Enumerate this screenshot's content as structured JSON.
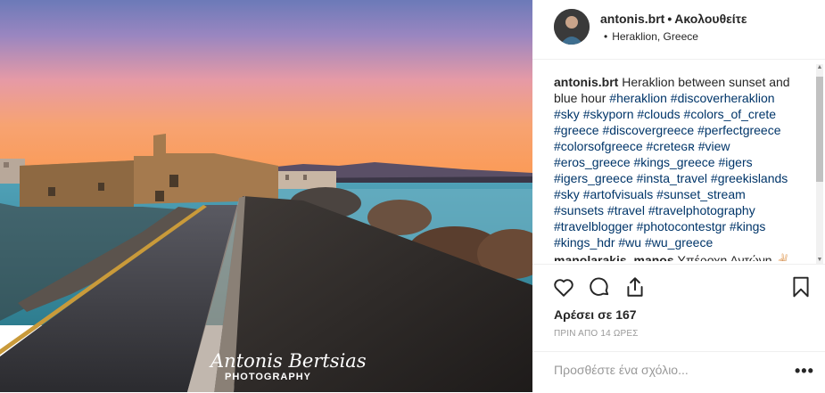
{
  "post": {
    "username": "antonis.brt",
    "separator": "•",
    "follow_label": "Ακολουθείτε",
    "location": "Heraklion, Greece",
    "location_bullet": "•"
  },
  "caption": {
    "username": "antonis.brt",
    "text": "Heraklion between sunset and blue hour",
    "hashtags": [
      "#heraklion",
      "#discoverheraklion",
      "#sky",
      "#skyporn",
      "#clouds",
      "#colors_of_crete",
      "#greece",
      "#discovergreece",
      "#perfectgreece",
      "#colorsofgreece",
      "#creteɢʀ",
      "#view",
      "#eros_greece",
      "#kings_greece",
      "#igers",
      "#igers_greece",
      "#insta_travel",
      "#greekislands",
      "#sky",
      "#artofvisuals",
      "#sunset_stream",
      "#sunsets",
      "#travel",
      "#travelphotography",
      "#travelblogger",
      "#photocontestgr",
      "#kings",
      "#kings_hdr",
      "#wu",
      "#wu_greece"
    ]
  },
  "comment": {
    "username": "manolarakis_manos",
    "text": "Υπέροχη Αντώνη ✌🏻"
  },
  "likes_label": "Αρέσει σε 167",
  "time_label": "ΠΡΙΝ ΑΠΟ 14 ΩΡΕΣ",
  "add_comment_placeholder": "Προσθέστε ένα σχόλιο...",
  "more_label": "•••",
  "watermark": {
    "name": "Antonis Bertsias",
    "sub": "PHOTOGRAPHY"
  },
  "icons": [
    "heart-icon",
    "comment-icon",
    "share-icon",
    "bookmark-icon"
  ],
  "colors": {
    "hashtag": "#003569",
    "text": "#262626",
    "muted": "#999999"
  }
}
